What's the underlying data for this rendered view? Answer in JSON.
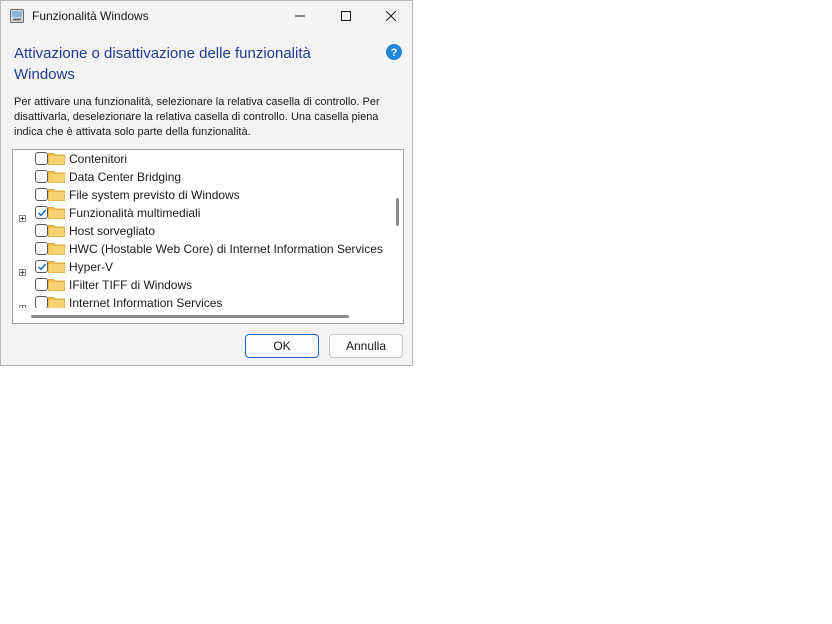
{
  "window": {
    "title": "Funzionalità Windows"
  },
  "dialog": {
    "heading": "Attivazione o disattivazione delle funzionalità Windows",
    "description": "Per attivare una funzionalità, selezionare la relativa casella di controllo. Per disattivarla, deselezionare la relativa casella di controllo. Una casella piena indica che è attivata solo parte della funzionalità."
  },
  "features": [
    {
      "label": "Contenitori",
      "checked": false,
      "expandable": false
    },
    {
      "label": "Data Center Bridging",
      "checked": false,
      "expandable": false
    },
    {
      "label": "File system previsto di Windows",
      "checked": false,
      "expandable": false
    },
    {
      "label": "Funzionalità multimediali",
      "checked": true,
      "expandable": true
    },
    {
      "label": "Host sorvegliato",
      "checked": false,
      "expandable": false
    },
    {
      "label": "HWC (Hostable Web Core) di Internet Information Services",
      "checked": false,
      "expandable": false
    },
    {
      "label": "Hyper-V",
      "checked": true,
      "expandable": true
    },
    {
      "label": "IFilter TIFF di Windows",
      "checked": false,
      "expandable": false
    },
    {
      "label": "Internet Information Services",
      "checked": false,
      "expandable": true
    }
  ],
  "buttons": {
    "ok": "OK",
    "cancel": "Annulla"
  },
  "colors": {
    "heading": "#1f3b8f",
    "accent": "#0067c0",
    "folder": "#f2c14e"
  },
  "icons": {
    "title": "control-panel-icon",
    "help": "help-icon",
    "folder": "folder-icon",
    "expander": "expand-plus-icon"
  }
}
